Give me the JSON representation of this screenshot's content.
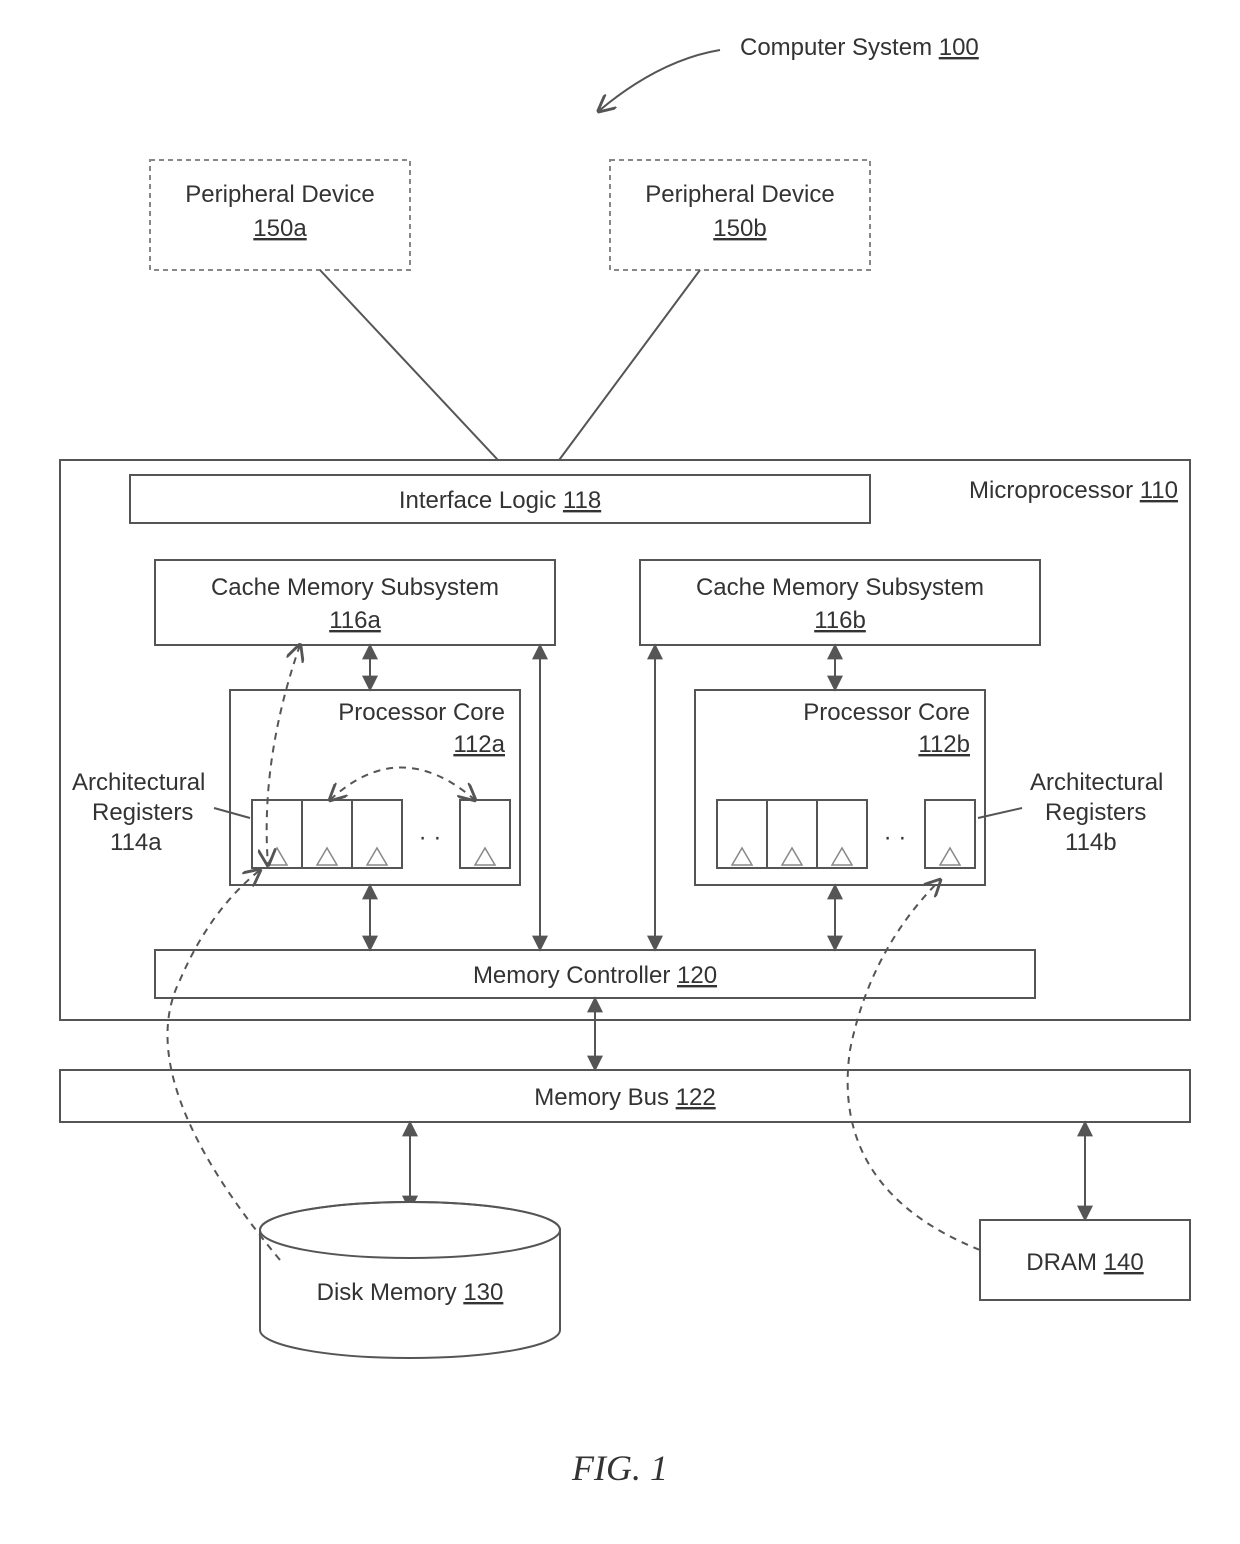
{
  "title_label": "Computer System",
  "title_num": "100",
  "peripheral_a_label": "Peripheral Device",
  "peripheral_a_num": "150a",
  "peripheral_b_label": "Peripheral Device",
  "peripheral_b_num": "150b",
  "microprocessor_label": "Microprocessor",
  "microprocessor_num": "110",
  "interface_logic_label": "Interface Logic",
  "interface_logic_num": "118",
  "cache_a_label": "Cache Memory Subsystem",
  "cache_a_num": "116a",
  "cache_b_label": "Cache Memory Subsystem",
  "cache_b_num": "116b",
  "core_a_label": "Processor Core",
  "core_a_num": "112a",
  "core_b_label": "Processor Core",
  "core_b_num": "112b",
  "arch_a_label1": "Architectural",
  "arch_a_label2": "Registers",
  "arch_a_num": "114a",
  "arch_b_label1": "Architectural",
  "arch_b_label2": "Registers",
  "arch_b_num": "114b",
  "memctl_label": "Memory Controller",
  "memctl_num": "120",
  "membus_label": "Memory Bus",
  "membus_num": "122",
  "disk_label": "Disk Memory",
  "disk_num": "130",
  "dram_label": "DRAM",
  "dram_num": "140",
  "fig_label": "FIG. 1"
}
